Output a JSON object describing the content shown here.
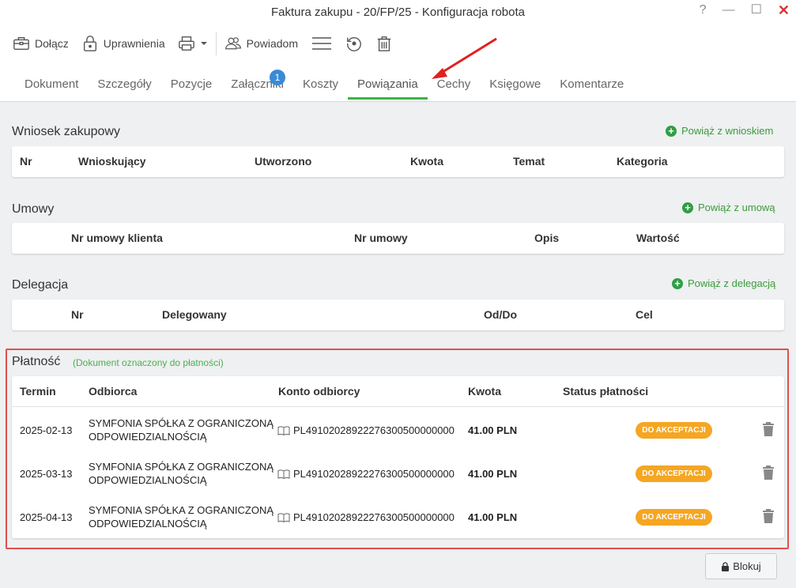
{
  "window": {
    "title": "Faktura zakupu - 20/FP/25 - Konfiguracja robota",
    "help": "?",
    "minimize": "—",
    "maximize": "☐",
    "close": "✕"
  },
  "toolbar": {
    "attach_label": "Dołącz",
    "permissions_label": "Uprawnienia",
    "notify_label": "Powiadom"
  },
  "tabs": [
    {
      "label": "Dokument"
    },
    {
      "label": "Szczegóły"
    },
    {
      "label": "Pozycje"
    },
    {
      "label": "Załączniki",
      "badge": "1"
    },
    {
      "label": "Koszty"
    },
    {
      "label": "Powiązania",
      "active": true
    },
    {
      "label": "Cechy"
    },
    {
      "label": "Księgowe"
    },
    {
      "label": "Komentarze"
    }
  ],
  "purchase_request": {
    "title": "Wniosek zakupowy",
    "link": "Powiąż z wnioskiem",
    "columns": [
      "Nr",
      "Wnioskujący",
      "Utworzono",
      "Kwota",
      "Temat",
      "Kategoria"
    ]
  },
  "contracts": {
    "title": "Umowy",
    "link": "Powiąż z umową",
    "columns": [
      "Nr umowy klienta",
      "Nr umowy",
      "Opis",
      "Wartość"
    ]
  },
  "delegation": {
    "title": "Delegacja",
    "link": "Powiąż z delegacją",
    "columns": [
      "Nr",
      "Delegowany",
      "Od/Do",
      "Cel"
    ]
  },
  "payment": {
    "title": "Płatność",
    "note": "(Dokument oznaczony do płatności)",
    "columns": [
      "Termin",
      "Odbiorca",
      "Konto odbiorcy",
      "Kwota",
      "Status płatności"
    ],
    "rows": [
      {
        "date": "2025-02-13",
        "recipient_line1": "SYMFONIA SPÓŁKA Z OGRANICZONĄ",
        "recipient_line2": "ODPOWIEDZIALNOŚCIĄ",
        "account": "PL49102028922276300500000000",
        "amount": "41.00 PLN",
        "status": "DO AKCEPTACJI"
      },
      {
        "date": "2025-03-13",
        "recipient_line1": "SYMFONIA SPÓŁKA Z OGRANICZONĄ",
        "recipient_line2": "ODPOWIEDZIALNOŚCIĄ",
        "account": "PL49102028922276300500000000",
        "amount": "41.00 PLN",
        "status": "DO AKCEPTACJI"
      },
      {
        "date": "2025-04-13",
        "recipient_line1": "SYMFONIA SPÓŁKA Z OGRANICZONĄ",
        "recipient_line2": "ODPOWIEDZIALNOŚCIĄ",
        "account": "PL49102028922276300500000000",
        "amount": "41.00 PLN",
        "status": "DO AKCEPTACJI"
      }
    ]
  },
  "block_button": "Blokuj",
  "colors": {
    "accent_green": "#3bb34a",
    "status_orange": "#f5a623",
    "highlight_red": "#e05050",
    "badge_blue": "#3a8ad6"
  }
}
